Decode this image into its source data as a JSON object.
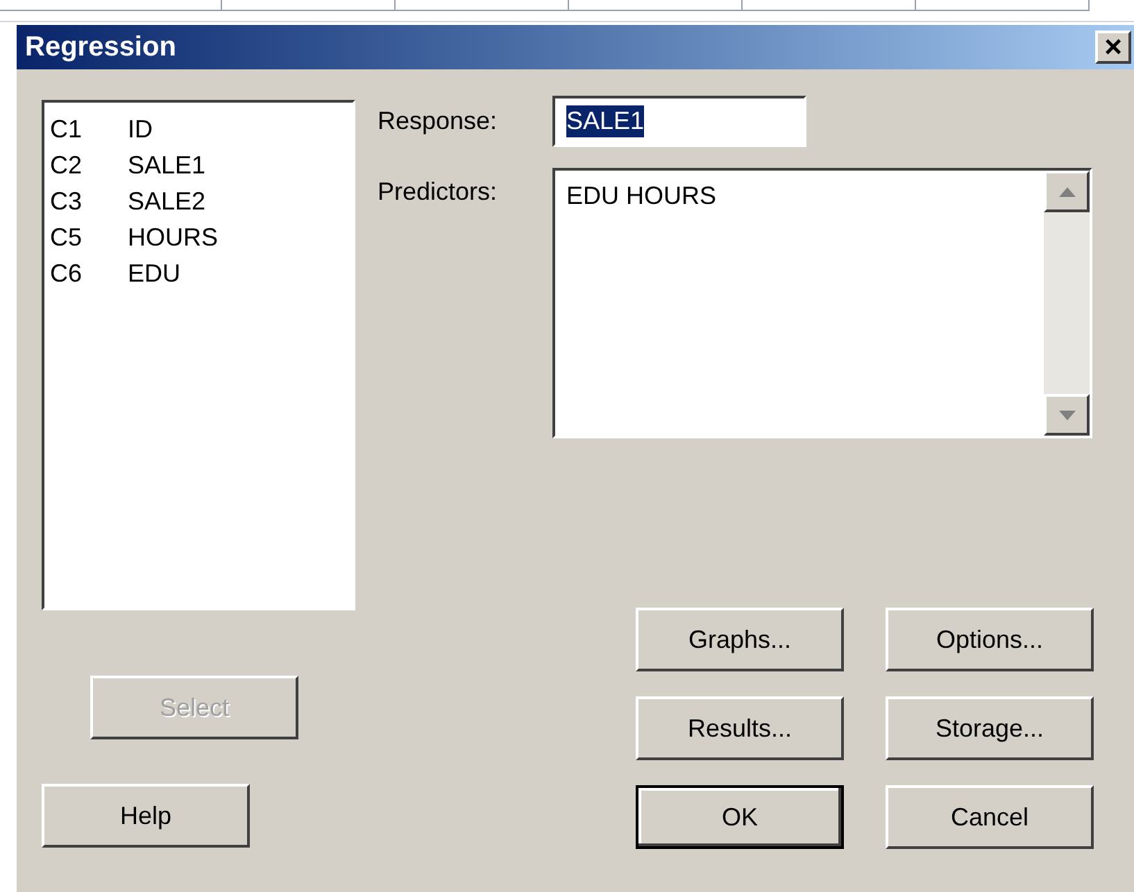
{
  "window": {
    "title": "Regression",
    "close": "×"
  },
  "columns": [
    {
      "id": "C1",
      "name": "ID"
    },
    {
      "id": "C2",
      "name": "SALE1"
    },
    {
      "id": "C3",
      "name": "SALE2"
    },
    {
      "id": "C5",
      "name": "HOURS"
    },
    {
      "id": "C6",
      "name": "EDU"
    }
  ],
  "response": {
    "label": "Response:",
    "value": "SALE1",
    "selected": true
  },
  "predictors": {
    "label": "Predictors:",
    "value": "EDU HOURS"
  },
  "left_buttons": [
    {
      "label": "Select",
      "disabled": true,
      "default": false
    },
    {
      "label": "Help",
      "disabled": false,
      "default": false
    }
  ],
  "buttons": [
    {
      "label": "Graphs...",
      "disabled": false,
      "default": false
    },
    {
      "label": "Options...",
      "disabled": false,
      "default": false
    },
    {
      "label": "Results...",
      "disabled": false,
      "default": false
    },
    {
      "label": "Storage...",
      "disabled": false,
      "default": false
    },
    {
      "label": "OK",
      "disabled": false,
      "default": true
    },
    {
      "label": "Cancel",
      "disabled": false,
      "default": false
    }
  ]
}
